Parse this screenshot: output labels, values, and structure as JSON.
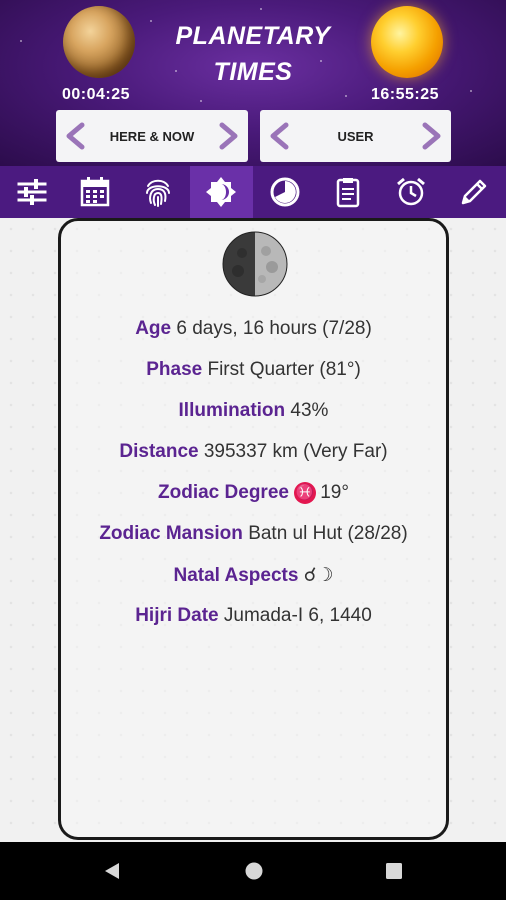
{
  "header": {
    "title_line1": "PLANETARY",
    "title_line2": "TIMES",
    "left_time": "00:04:25",
    "right_time": "16:55:25",
    "left_nav_label": "HERE & NOW",
    "right_nav_label": "USER"
  },
  "toolbar": {
    "icons": [
      "sliders-icon",
      "calendar-icon",
      "fingerprint-icon",
      "moon-phase-icon",
      "pie-clock-icon",
      "clipboard-icon",
      "alarm-icon",
      "pencil-icon"
    ],
    "active_index": 3
  },
  "moon_info": {
    "age_label": "Age",
    "age_value": "6 days, 16 hours (7/28)",
    "phase_label": "Phase",
    "phase_value": "First Quarter (81°)",
    "illumination_label": "Illumination",
    "illumination_value": "43%",
    "distance_label": "Distance",
    "distance_value": "395337 km (Very Far)",
    "zodiac_degree_label": "Zodiac Degree",
    "zodiac_sign_symbol": "♓",
    "zodiac_degree_value": "19°",
    "zodiac_mansion_label": "Zodiac Mansion",
    "zodiac_mansion_value": "Batn ul Hut (28/28)",
    "natal_aspects_label": "Natal Aspects",
    "natal_aspects_value": "☌☽",
    "hijri_label": "Hijri Date",
    "hijri_value": "Jumada-I 6, 1440"
  },
  "colors": {
    "accent_purple": "#5b2491",
    "toolbar_bg": "#4b1a80",
    "pisces_badge": "#e3174f"
  }
}
